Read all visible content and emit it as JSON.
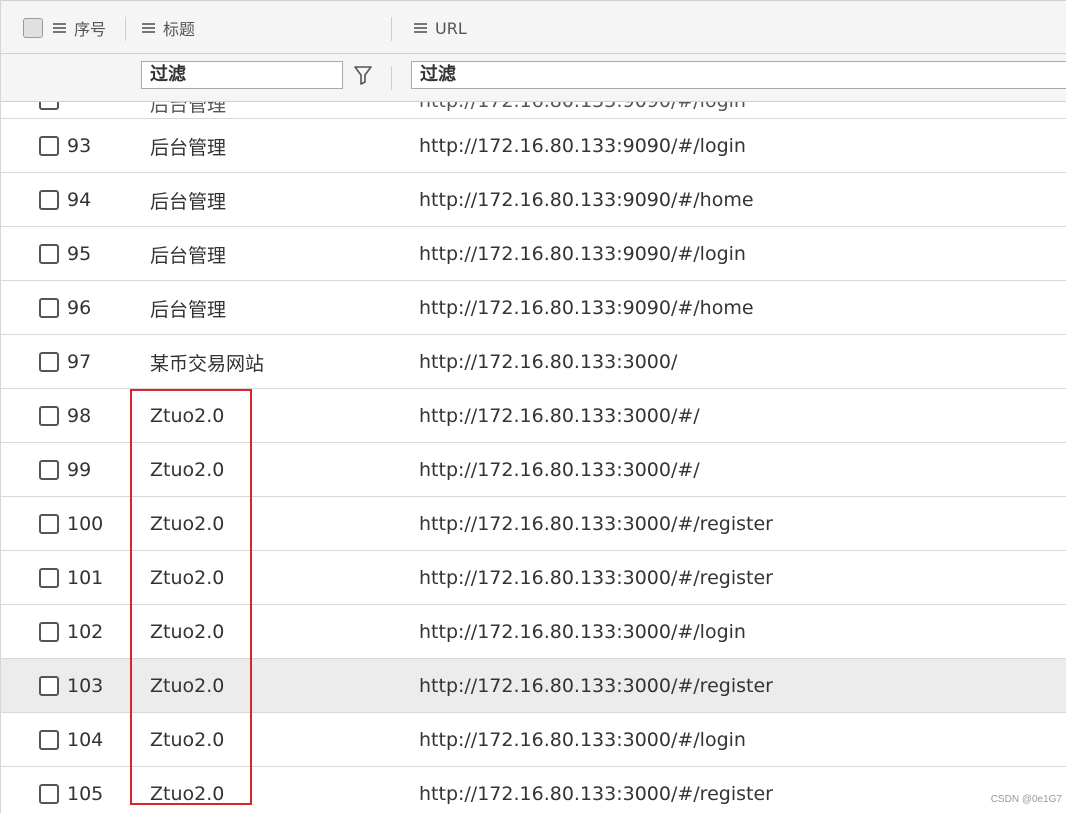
{
  "header": {
    "col_num": "序号",
    "col_title": "标题",
    "col_url": "URL"
  },
  "filter": {
    "title_placeholder": "过滤",
    "url_placeholder": "过滤"
  },
  "rows": [
    {
      "num": "93",
      "title": "后台管理",
      "url": "http://172.16.80.133:9090/#/login"
    },
    {
      "num": "94",
      "title": "后台管理",
      "url": "http://172.16.80.133:9090/#/home"
    },
    {
      "num": "95",
      "title": "后台管理",
      "url": "http://172.16.80.133:9090/#/login"
    },
    {
      "num": "96",
      "title": "后台管理",
      "url": "http://172.16.80.133:9090/#/home"
    },
    {
      "num": "97",
      "title": "某币交易网站",
      "url": "http://172.16.80.133:3000/"
    },
    {
      "num": "98",
      "title": "Ztuo2.0",
      "url": "http://172.16.80.133:3000/#/"
    },
    {
      "num": "99",
      "title": "Ztuo2.0",
      "url": "http://172.16.80.133:3000/#/"
    },
    {
      "num": "100",
      "title": "Ztuo2.0",
      "url": "http://172.16.80.133:3000/#/register"
    },
    {
      "num": "101",
      "title": "Ztuo2.0",
      "url": "http://172.16.80.133:3000/#/register"
    },
    {
      "num": "102",
      "title": "Ztuo2.0",
      "url": "http://172.16.80.133:3000/#/login"
    },
    {
      "num": "103",
      "title": "Ztuo2.0",
      "url": "http://172.16.80.133:3000/#/register"
    },
    {
      "num": "104",
      "title": "Ztuo2.0",
      "url": "http://172.16.80.133:3000/#/login"
    },
    {
      "num": "105",
      "title": "Ztuo2.0",
      "url": "http://172.16.80.133:3000/#/register"
    }
  ],
  "highlighted_row": "103",
  "annotation_color": "#d9262c",
  "watermark": "CSDN @0e1G7"
}
